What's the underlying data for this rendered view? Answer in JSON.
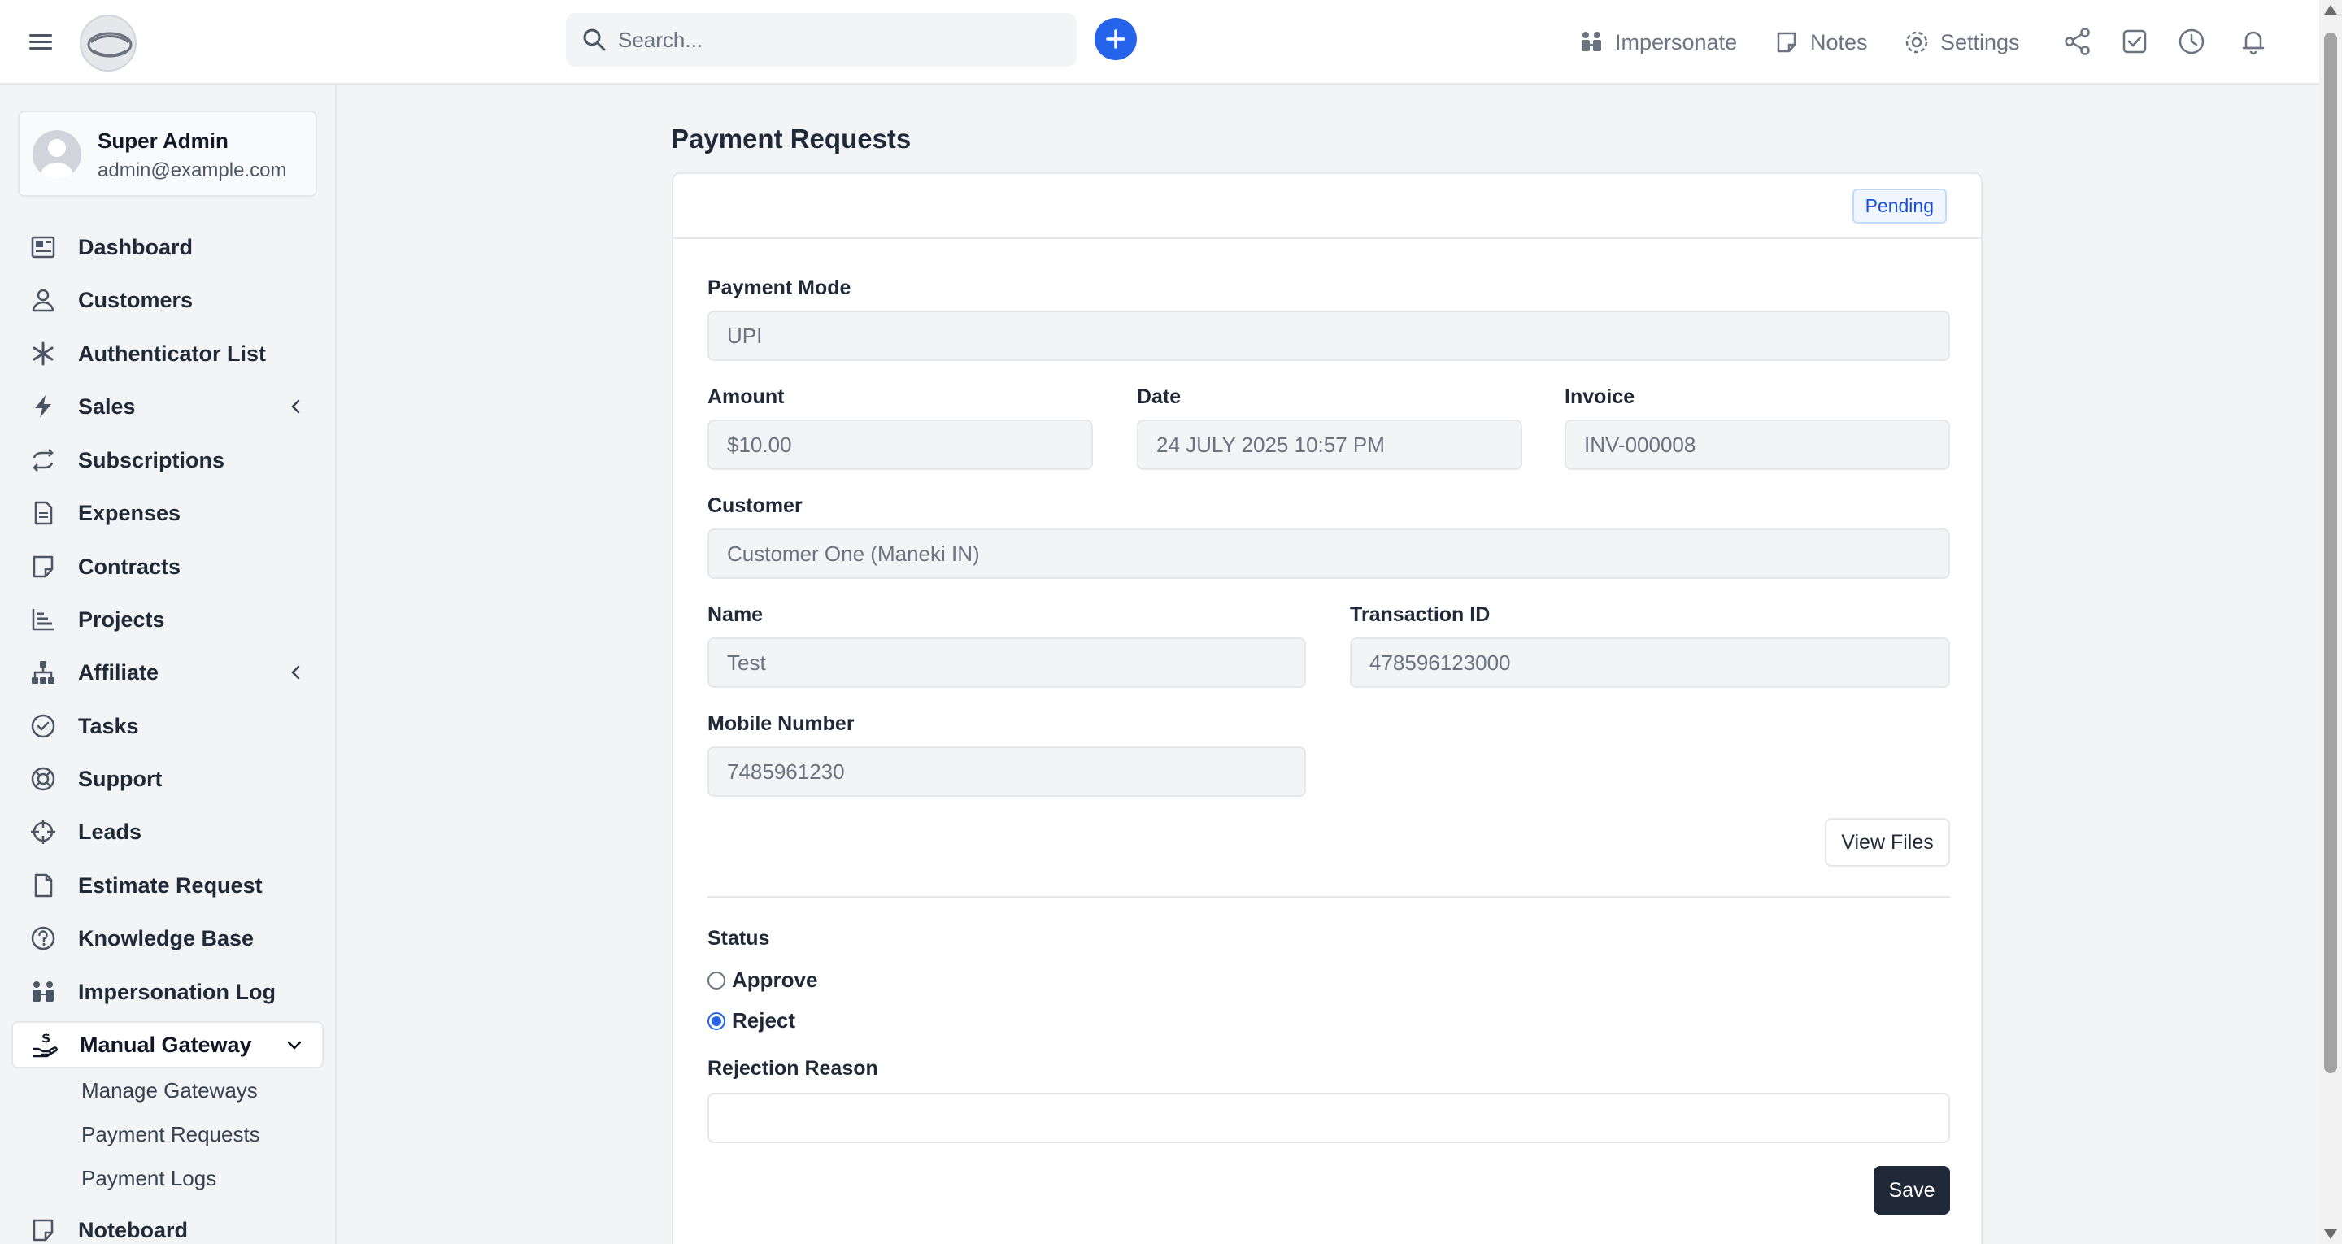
{
  "header": {
    "search_placeholder": "Search...",
    "impersonate_label": "Impersonate",
    "notes_label": "Notes",
    "settings_label": "Settings",
    "accent_color": "#2563eb"
  },
  "user": {
    "name": "Super Admin",
    "email": "admin@example.com"
  },
  "sidebar": {
    "items": [
      {
        "label": "Dashboard",
        "icon": "dashboard-icon"
      },
      {
        "label": "Customers",
        "icon": "user-icon"
      },
      {
        "label": "Authenticator List",
        "icon": "asterisk-icon"
      },
      {
        "label": "Sales",
        "icon": "bolt-icon"
      },
      {
        "label": "Subscriptions",
        "icon": "repeat-icon"
      },
      {
        "label": "Expenses",
        "icon": "receipt-icon"
      },
      {
        "label": "Contracts",
        "icon": "note-icon"
      },
      {
        "label": "Projects",
        "icon": "chart-icon"
      },
      {
        "label": "Affiliate",
        "icon": "sitemap-icon"
      },
      {
        "label": "Tasks",
        "icon": "check-circle-icon"
      },
      {
        "label": "Support",
        "icon": "lifebuoy-icon"
      },
      {
        "label": "Leads",
        "icon": "crosshair-icon"
      },
      {
        "label": "Estimate Request",
        "icon": "file-icon"
      },
      {
        "label": "Knowledge Base",
        "icon": "question-icon"
      },
      {
        "label": "Impersonation Log",
        "icon": "people-icon"
      },
      {
        "label": "Manual Gateway",
        "icon": "hand-money-icon"
      },
      {
        "label": "Noteboard",
        "icon": "note-icon"
      }
    ],
    "sub_items": [
      {
        "label": "Manage Gateways"
      },
      {
        "label": "Payment Requests"
      },
      {
        "label": "Payment Logs"
      }
    ]
  },
  "page": {
    "title": "Payment Requests",
    "status_badge": "Pending"
  },
  "form": {
    "payment_mode": {
      "label": "Payment Mode",
      "value": "UPI"
    },
    "amount": {
      "label": "Amount",
      "value": "$10.00"
    },
    "date": {
      "label": "Date",
      "value": "24 JULY 2025 10:57 PM"
    },
    "invoice": {
      "label": "Invoice",
      "value": "INV-000008"
    },
    "customer": {
      "label": "Customer",
      "value": "Customer One (Maneki IN)"
    },
    "name": {
      "label": "Name",
      "value": "Test"
    },
    "transaction_id": {
      "label": "Transaction ID",
      "value": "478596123000"
    },
    "mobile": {
      "label": "Mobile Number",
      "value": "7485961230"
    },
    "view_files_label": "View Files",
    "status_label": "Status",
    "approve_label": "Approve",
    "reject_label": "Reject",
    "selected_status": "Reject",
    "rejection_reason_label": "Rejection Reason",
    "rejection_reason_value": "",
    "save_label": "Save"
  }
}
